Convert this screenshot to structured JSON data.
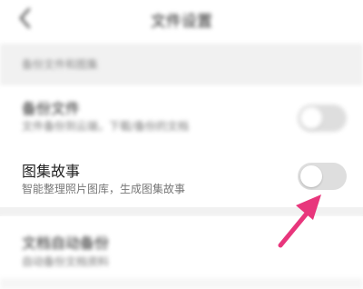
{
  "header": {
    "title": "文件设置"
  },
  "section": {
    "label": "备份文件和图集"
  },
  "rows": [
    {
      "title": "备份文件",
      "subtitle": "文件备份到云端，下载/备份的文档",
      "toggle_on": false
    },
    {
      "title": "图集故事",
      "subtitle": "智能整理照片图库，生成图集故事",
      "toggle_on": false
    },
    {
      "title": "文档自动备份",
      "subtitle": "自动备份文档资料"
    }
  ],
  "colors": {
    "arrow": "#e8367c",
    "toggle_off": "#dedede",
    "section_bg": "#f1f1f1"
  },
  "icons": {
    "back": "chevron-left-icon",
    "annotation": "arrow-annotation"
  }
}
